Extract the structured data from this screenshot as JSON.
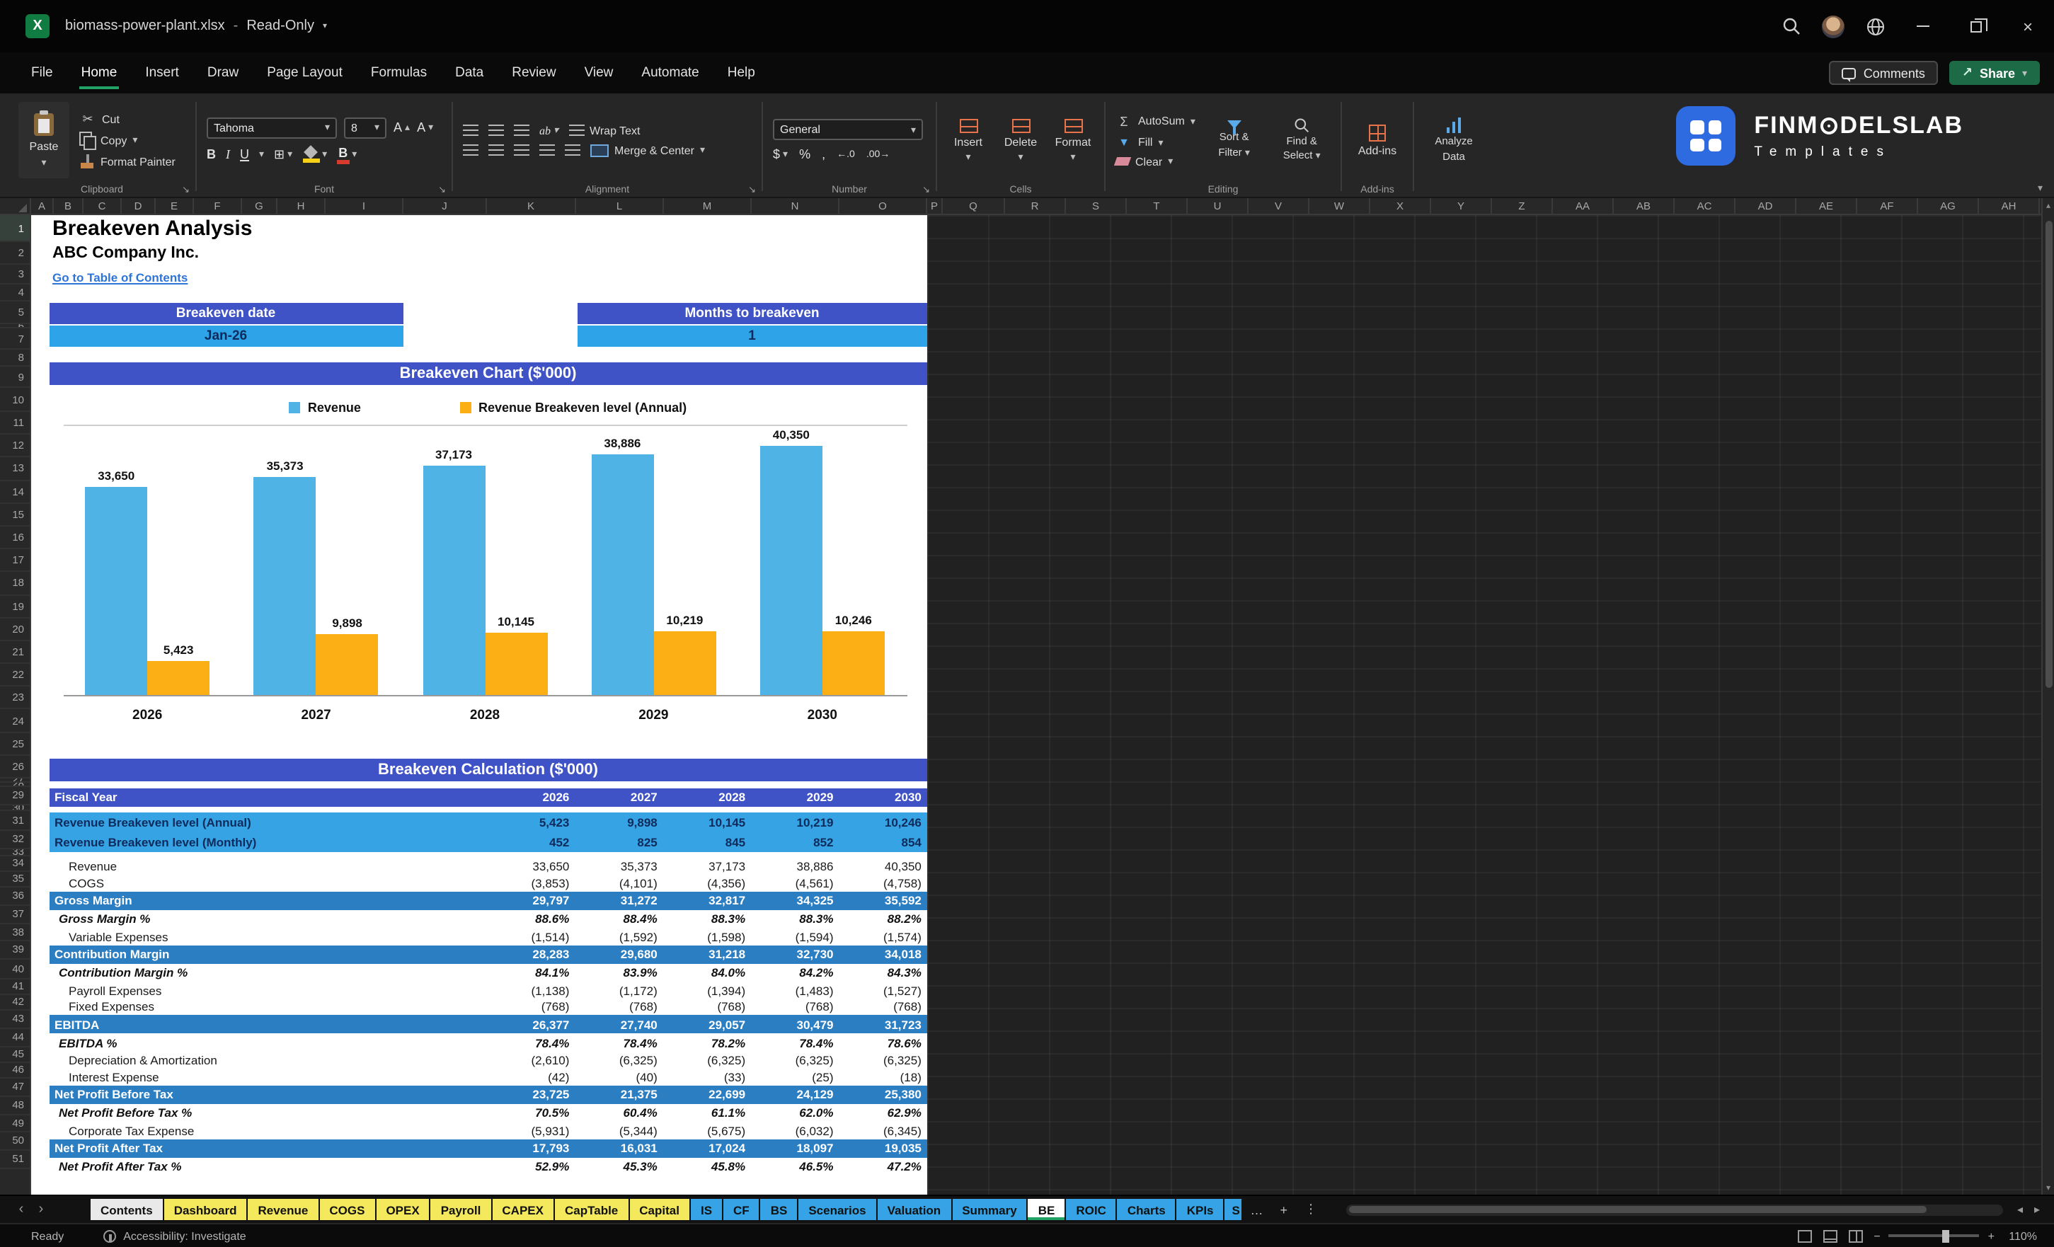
{
  "colors": {
    "banner": "#4053C6",
    "card_value": "#2FA3E8",
    "highlight_row": "#36A3E4",
    "subtotal_row": "#2C7EC3",
    "tab_yellow": "#F4E95C",
    "tab_blue": "#35A3E5",
    "accent_green": "#21A366",
    "link_blue": "#2E75D8",
    "navy_text": "#0E2B5C"
  },
  "icons": {
    "dropdown": "▾",
    "excel_logo": "X",
    "close": "×",
    "share_arrow": "↗",
    "dialog_launcher": "↘",
    "scissors": "✂",
    "autosum": "Σ",
    "fill_down": "▼",
    "dollar": "$",
    "percent": "%",
    "comma": ",",
    "border_all": "⊞",
    "bold": "B",
    "italic": "I",
    "underline": "U",
    "orientation": "ab",
    "increase_decimal": "←.0",
    "decrease_decimal": ".00→",
    "prev_sheet": "‹",
    "next_sheet": "›",
    "more_sheets": "…",
    "add_sheet": "+",
    "vertical_dots": "⋮",
    "scroll_up": "▴",
    "scroll_down": "▾",
    "scroll_left": "◂",
    "scroll_right": "▸",
    "ribbon_collapse": "▾",
    "zoom_out": "−",
    "zoom_in": "+"
  },
  "titlebar": {
    "filename": "biomass-power-plant.xlsx",
    "separator": "-",
    "mode": "Read-Only"
  },
  "menubar": {
    "items": [
      "File",
      "Home",
      "Insert",
      "Draw",
      "Page Layout",
      "Formulas",
      "Data",
      "Review",
      "View",
      "Automate",
      "Help"
    ],
    "active": "Home",
    "comments": "Comments",
    "share": "Share"
  },
  "ribbon": {
    "clipboard": {
      "label": "Clipboard",
      "paste": "Paste",
      "cut": "Cut",
      "copy": "Copy",
      "format_painter": "Format Painter"
    },
    "font": {
      "label": "Font",
      "family": "Tahoma",
      "size": "8"
    },
    "alignment": {
      "label": "Alignment",
      "wrap_text": "Wrap Text",
      "merge_center": "Merge & Center"
    },
    "number": {
      "label": "Number",
      "format": "General"
    },
    "cells": {
      "label": "Cells",
      "insert": "Insert",
      "delete": "Delete",
      "format": "Format"
    },
    "editing": {
      "label": "Editing",
      "autosum": "AutoSum",
      "fill": "Fill",
      "clear": "Clear",
      "sort_line1": "Sort &",
      "sort_line2": "Filter",
      "find_line1": "Find &",
      "find_line2": "Select"
    },
    "addins": {
      "label": "Add-ins",
      "addins": "Add-ins",
      "analyze_line1": "Analyze",
      "analyze_line2": "Data"
    }
  },
  "brand": {
    "prefix": "FINM",
    "suffix": "DELSLAB",
    "subtitle": "Templates"
  },
  "grid": {
    "columns": [
      "A",
      "B",
      "C",
      "D",
      "E",
      "F",
      "G",
      "H",
      "I",
      "J",
      "K",
      "L",
      "M",
      "N",
      "O",
      "P",
      "Q",
      "R",
      "S",
      "T",
      "U",
      "V",
      "W",
      "X",
      "Y",
      "Z",
      "AA",
      "AB",
      "AC",
      "AD",
      "AE",
      "AF",
      "AG",
      "AH"
    ],
    "row_count": 51
  },
  "sheet": {
    "title": "Breakeven Analysis",
    "company": "ABC Company Inc.",
    "toc_link": "Go to Table of Contents",
    "cards": [
      {
        "label": "Breakeven date",
        "value": "Jan-26"
      },
      {
        "label": "Months to breakeven",
        "value": "1"
      }
    ],
    "calc_banner": "Breakeven Calculation ($'000)"
  },
  "chart_data": {
    "type": "bar",
    "title": "Breakeven Chart ($'000)",
    "categories": [
      "2026",
      "2027",
      "2028",
      "2029",
      "2030"
    ],
    "series": [
      {
        "name": "Revenue",
        "color": "#4FB3E5",
        "values": [
          33650,
          35373,
          37173,
          38886,
          40350
        ]
      },
      {
        "name": "Revenue Breakeven level (Annual)",
        "color": "#FCAF15",
        "values": [
          5423,
          9898,
          10145,
          10219,
          10246
        ]
      }
    ],
    "ylim": [
      0,
      44000
    ],
    "grid": false,
    "legend_position": "top",
    "value_labels": true
  },
  "table": {
    "header": {
      "label": "Fiscal Year",
      "years": [
        "2026",
        "2027",
        "2028",
        "2029",
        "2030"
      ]
    },
    "rows": [
      {
        "type": "highlight",
        "label": "Revenue Breakeven level (Annual)",
        "values": [
          "5,423",
          "9,898",
          "10,145",
          "10,219",
          "10,246"
        ]
      },
      {
        "type": "highlight",
        "label": "Revenue Breakeven level (Monthly)",
        "values": [
          "452",
          "825",
          "845",
          "852",
          "854"
        ]
      },
      {
        "type": "detail",
        "label": "Revenue",
        "values": [
          "33,650",
          "35,373",
          "37,173",
          "38,886",
          "40,350"
        ]
      },
      {
        "type": "detail",
        "label": "COGS",
        "values": [
          "(3,853)",
          "(4,101)",
          "(4,356)",
          "(4,561)",
          "(4,758)"
        ]
      },
      {
        "type": "subtotal",
        "label": "Gross Margin",
        "values": [
          "29,797",
          "31,272",
          "32,817",
          "34,325",
          "35,592"
        ]
      },
      {
        "type": "pct",
        "label": "Gross Margin %",
        "values": [
          "88.6%",
          "88.4%",
          "88.3%",
          "88.3%",
          "88.2%"
        ]
      },
      {
        "type": "detail",
        "label": "Variable Expenses",
        "values": [
          "(1,514)",
          "(1,592)",
          "(1,598)",
          "(1,594)",
          "(1,574)"
        ]
      },
      {
        "type": "subtotal",
        "label": "Contribution Margin",
        "values": [
          "28,283",
          "29,680",
          "31,218",
          "32,730",
          "34,018"
        ]
      },
      {
        "type": "pct",
        "label": "Contribution Margin %",
        "values": [
          "84.1%",
          "83.9%",
          "84.0%",
          "84.2%",
          "84.3%"
        ]
      },
      {
        "type": "detail",
        "label": "Payroll Expenses",
        "values": [
          "(1,138)",
          "(1,172)",
          "(1,394)",
          "(1,483)",
          "(1,527)"
        ]
      },
      {
        "type": "detail",
        "label": "Fixed Expenses",
        "values": [
          "(768)",
          "(768)",
          "(768)",
          "(768)",
          "(768)"
        ]
      },
      {
        "type": "subtotal",
        "label": "EBITDA",
        "values": [
          "26,377",
          "27,740",
          "29,057",
          "30,479",
          "31,723"
        ]
      },
      {
        "type": "pct",
        "label": "EBITDA %",
        "values": [
          "78.4%",
          "78.4%",
          "78.2%",
          "78.4%",
          "78.6%"
        ]
      },
      {
        "type": "detail",
        "label": "Depreciation & Amortization",
        "values": [
          "(2,610)",
          "(6,325)",
          "(6,325)",
          "(6,325)",
          "(6,325)"
        ]
      },
      {
        "type": "detail",
        "label": "Interest Expense",
        "values": [
          "(42)",
          "(40)",
          "(33)",
          "(25)",
          "(18)"
        ]
      },
      {
        "type": "subtotal",
        "label": "Net Profit Before Tax",
        "values": [
          "23,725",
          "21,375",
          "22,699",
          "24,129",
          "25,380"
        ]
      },
      {
        "type": "pct",
        "label": "Net Profit Before Tax %",
        "values": [
          "70.5%",
          "60.4%",
          "61.1%",
          "62.0%",
          "62.9%"
        ]
      },
      {
        "type": "detail",
        "label": "Corporate Tax Expense",
        "values": [
          "(5,931)",
          "(5,344)",
          "(5,675)",
          "(6,032)",
          "(6,345)"
        ]
      },
      {
        "type": "subtotal",
        "label": "Net Profit After Tax",
        "values": [
          "17,793",
          "16,031",
          "17,024",
          "18,097",
          "19,035"
        ]
      },
      {
        "type": "pct",
        "label": "Net Profit After Tax %",
        "values": [
          "52.9%",
          "45.3%",
          "45.8%",
          "46.5%",
          "47.2%"
        ]
      }
    ]
  },
  "sheet_tabs": {
    "active": "BE",
    "items": [
      {
        "label": "Contents",
        "color": "light"
      },
      {
        "label": "Dashboard",
        "color": "yellow"
      },
      {
        "label": "Revenue",
        "color": "yellow"
      },
      {
        "label": "COGS",
        "color": "yellow"
      },
      {
        "label": "OPEX",
        "color": "yellow"
      },
      {
        "label": "Payroll",
        "color": "yellow"
      },
      {
        "label": "CAPEX",
        "color": "yellow"
      },
      {
        "label": "CapTable",
        "color": "yellow"
      },
      {
        "label": "Capital",
        "color": "yellow"
      },
      {
        "label": "IS",
        "color": "blue"
      },
      {
        "label": "CF",
        "color": "blue"
      },
      {
        "label": "BS",
        "color": "blue"
      },
      {
        "label": "Scenarios",
        "color": "blue"
      },
      {
        "label": "Valuation",
        "color": "blue"
      },
      {
        "label": "Summary",
        "color": "blue"
      },
      {
        "label": "BE",
        "color": "active"
      },
      {
        "label": "ROIC",
        "color": "blue"
      },
      {
        "label": "Charts",
        "color": "blue"
      },
      {
        "label": "KPIs",
        "color": "blue"
      },
      {
        "label": "S",
        "color": "cut"
      }
    ]
  },
  "statusbar": {
    "ready": "Ready",
    "accessibility": "Accessibility: Investigate",
    "zoom": "110%"
  }
}
